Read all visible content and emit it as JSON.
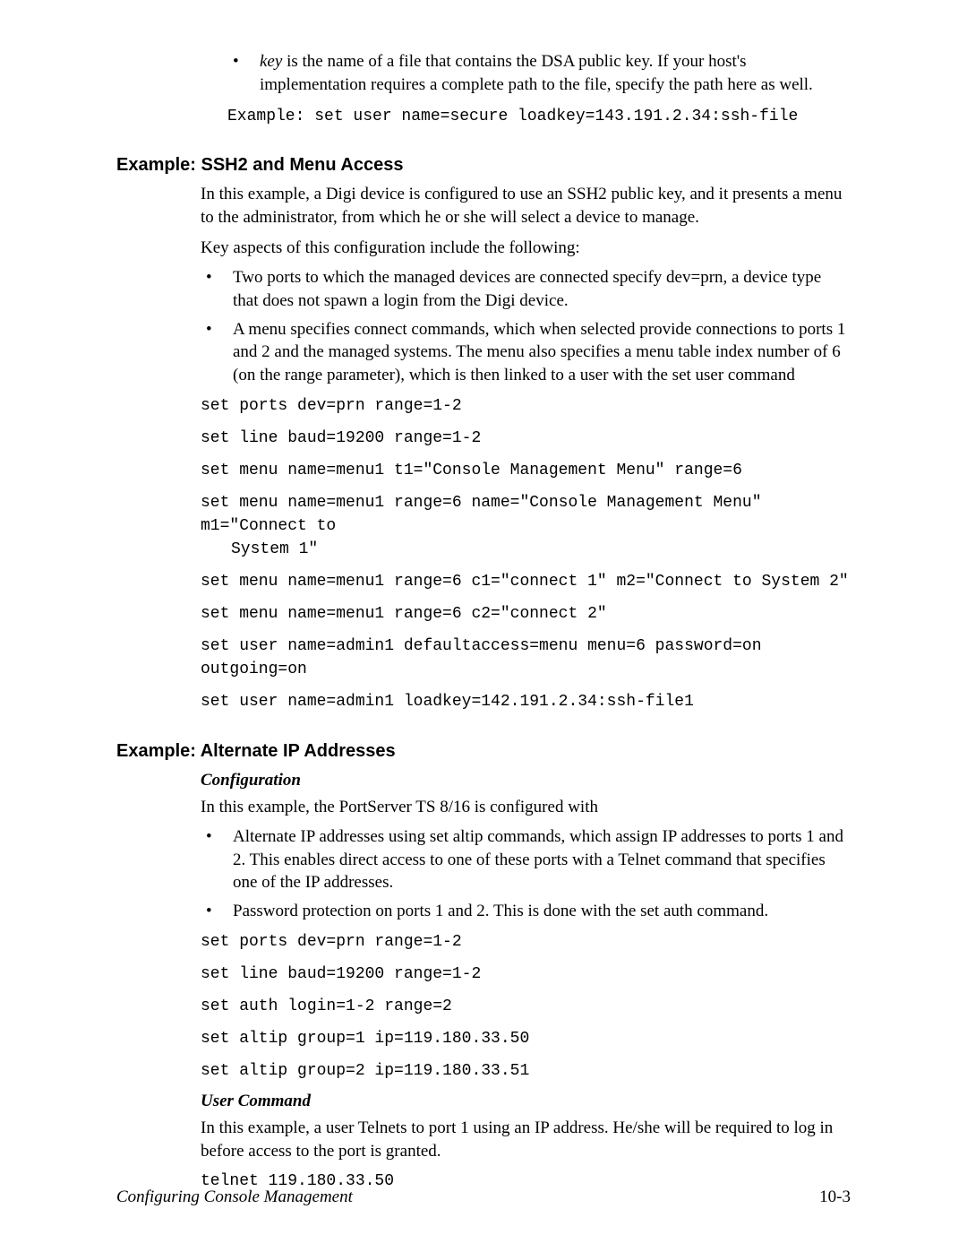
{
  "top_bullet": {
    "term": "key",
    "rest": " is the name of a file that contains the DSA public key. If your host's implementation requires a complete path to the file, specify the path here as well."
  },
  "top_example": "Example: set user name=secure loadkey=143.191.2.34:ssh-file",
  "sec1": {
    "heading": "Example: SSH2 and Menu Access",
    "p1": "In this example, a Digi device is configured to use an SSH2 public key, and it presents a menu to the administrator, from which he or she will select a device to manage.",
    "p2": "Key aspects of this configuration include the following:",
    "b1": "Two ports to which the managed devices are connected specify dev=prn, a device type that does not spawn a login from the Digi device.",
    "b2": "A menu specifies connect commands, which when selected provide connections to ports 1 and 2 and the managed systems. The menu also specifies a menu table index number of 6 (on the range parameter), which is then linked to a user with the set user command",
    "c1": "set ports dev=prn range=1-2",
    "c2": "set line baud=19200 range=1-2",
    "c3": "set menu name=menu1 t1=\"Console Management Menu\" range=6",
    "c4a": "set menu name=menu1 range=6 name=\"Console Management Menu\" m1=\"Connect to",
    "c4b": "System 1\"",
    "c5": "set menu name=menu1 range=6 c1=\"connect 1\" m2=\"Connect to System 2\"",
    "c6": "set menu name=menu1 range=6 c2=\"connect 2\"",
    "c7": "set user name=admin1 defaultaccess=menu menu=6 password=on  outgoing=on",
    "c8": "set user name=admin1 loadkey=142.191.2.34:ssh-file1"
  },
  "sec2": {
    "heading": "Example: Alternate IP Addresses",
    "sub1": "Configuration",
    "p1": "In this example, the PortServer TS 8/16 is configured with",
    "b1": "Alternate IP addresses using set altip commands, which assign IP addresses to ports 1 and 2. This enables direct access to one of these ports with a Telnet command that specifies one of the IP addresses.",
    "b2": "Password protection on ports 1 and 2. This is done with the set auth command.",
    "c1": "set ports dev=prn range=1-2",
    "c2": "set line baud=19200 range=1-2",
    "c3": "set auth login=1-2 range=2",
    "c4": "set altip group=1 ip=119.180.33.50",
    "c5": "set altip group=2 ip=119.180.33.51",
    "sub2": "User Command",
    "p2": "In this example, a user Telnets to port 1 using an IP address. He/she will be required to log in before access to the port is granted.",
    "c6": "telnet 119.180.33.50"
  },
  "footer": {
    "left": "Configuring Console Management",
    "right": "10-3"
  }
}
